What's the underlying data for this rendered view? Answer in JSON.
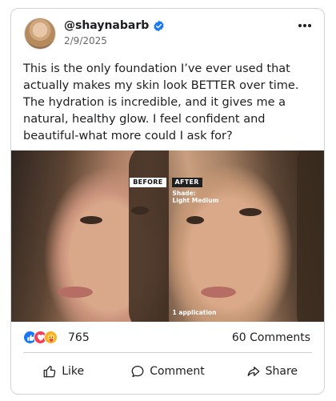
{
  "post": {
    "username": "@shaynabarb",
    "date": "2/9/2025",
    "text": "This is the only foundation I’ve ever used that actually makes my skin look BETTER over time. The hydration is incredible, and it gives me a natural, healthy glow. I feel confident and beautiful-what more could I ask for?",
    "image": {
      "before_label": "BEFORE",
      "after_label": "AFTER",
      "shade_label": "Shade:",
      "shade_value": "Light Medium",
      "applications": "1 application"
    },
    "reactions": {
      "icons": [
        "like-icon",
        "love-icon",
        "care-icon"
      ],
      "count": "765"
    },
    "comments_count": "60 Comments"
  },
  "actions": {
    "like_label": "Like",
    "comment_label": "Comment",
    "share_label": "Share"
  },
  "colors": {
    "verified": "#1877f2",
    "like": "#1877f2",
    "love": "#f33e58",
    "care": "#f7b125",
    "border": "#d0d3d8"
  }
}
